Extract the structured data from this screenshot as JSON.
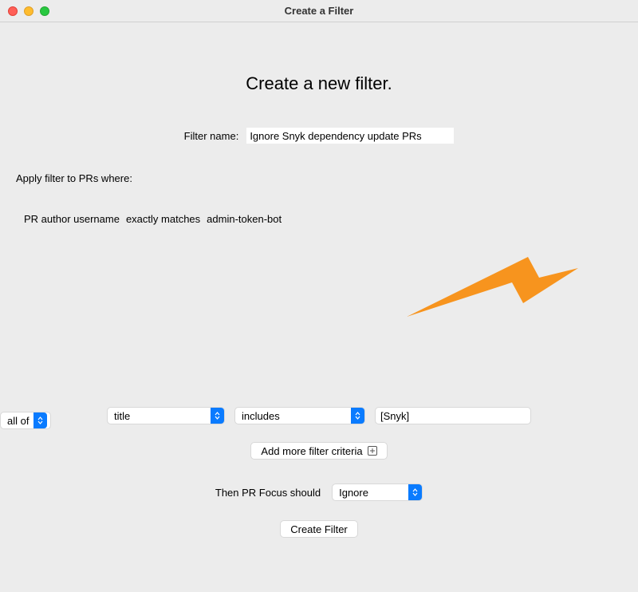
{
  "window": {
    "title": "Create a Filter"
  },
  "heading": "Create a new filter.",
  "filter_name": {
    "label": "Filter name:",
    "value": "Ignore Snyk dependency update PRs"
  },
  "apply_label": "Apply filter to PRs where:",
  "condition": {
    "field": "PR author username",
    "operator": "exactly matches",
    "value": "admin-token-bot"
  },
  "combiner": {
    "selected": "all of"
  },
  "criteria": {
    "field_select": "title",
    "operator_select": "includes",
    "value": "[Snyk]"
  },
  "add_criteria_button": "Add more filter criteria",
  "action": {
    "label": "Then PR Focus should",
    "selected": "Ignore"
  },
  "create_button": "Create Filter"
}
